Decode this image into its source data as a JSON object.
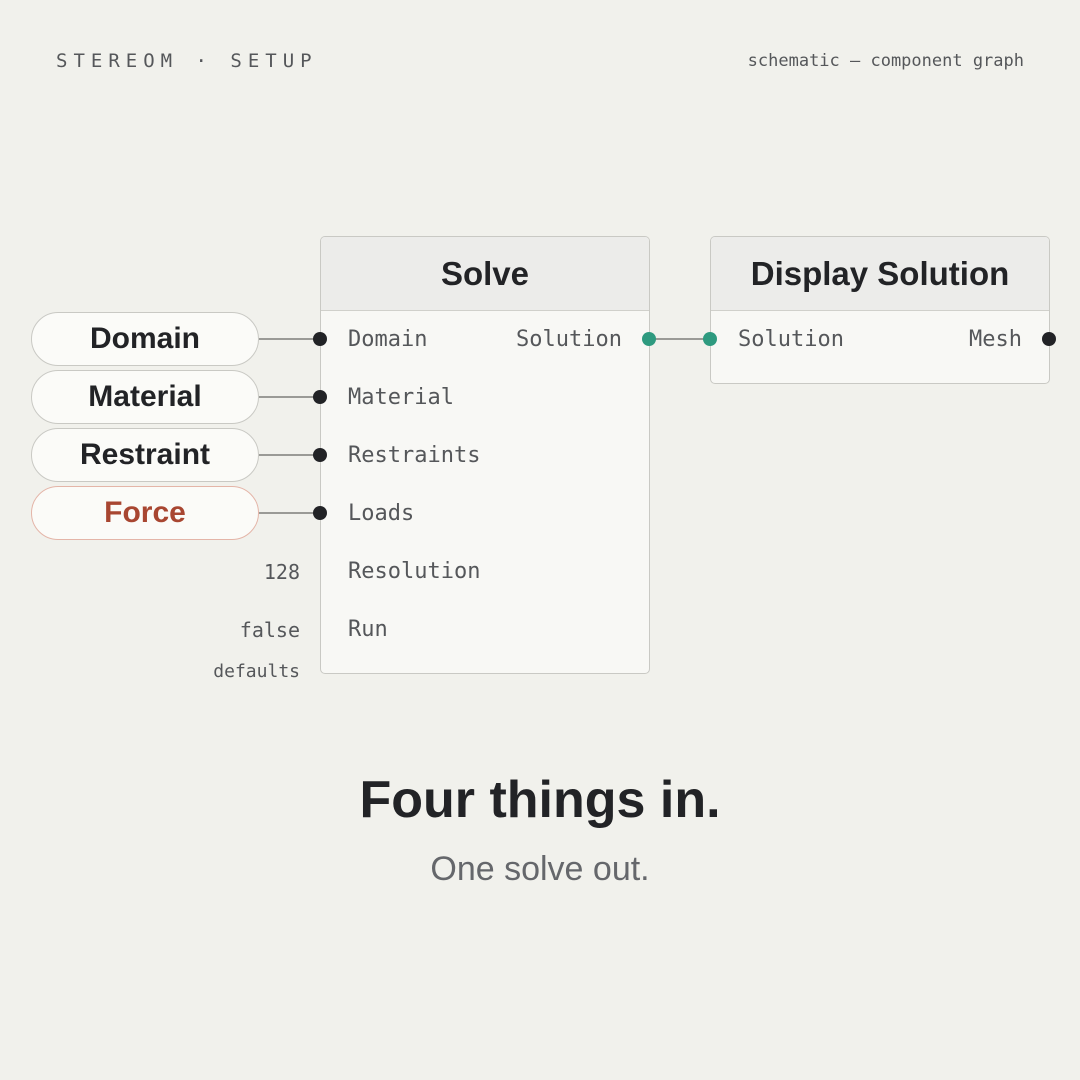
{
  "header": {
    "brand": "STEREOM · SETUP",
    "subtitle": "schematic — component graph"
  },
  "inputs": [
    {
      "label": "Domain"
    },
    {
      "label": "Material"
    },
    {
      "label": "Restraint"
    },
    {
      "label": "Force",
      "accent": "#a84631"
    }
  ],
  "defaults": {
    "resolution": "128",
    "run": "false",
    "caption": "defaults"
  },
  "solve_node": {
    "title": "Solve",
    "inputs": [
      "Domain",
      "Material",
      "Restraints",
      "Loads",
      "Resolution",
      "Run"
    ],
    "output": "Solution"
  },
  "display_node": {
    "title": "Display Solution",
    "input": "Solution",
    "output": "Mesh"
  },
  "footer": {
    "headline": "Four things in.",
    "tagline": "One solve out."
  },
  "colors": {
    "background": "#f1f1ec",
    "port": "#222326",
    "solution_port": "#2e9a7f",
    "force": "#a84631"
  }
}
